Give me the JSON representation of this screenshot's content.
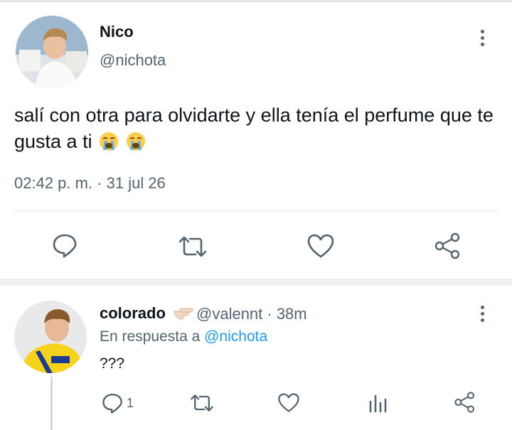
{
  "tweet": {
    "name": "Nico",
    "handle": "@nichota",
    "text": "salí con otra para olvidarte y ella tenía el perfume que te gusta a ti",
    "emojis": [
      "loudly-crying-face",
      "loudly-crying-face"
    ],
    "timestamp": "02:42 p. m. · 31 jul 26",
    "actions": [
      "reply-icon",
      "retweet-icon",
      "like-icon",
      "share-icon"
    ]
  },
  "reply": {
    "name": "colorado",
    "name_emoji": "pointing-hand",
    "handle_time": "@valennt · 38m",
    "replying_prefix": "En respuesta a",
    "replying_to": "@nichota",
    "text": "???",
    "reply_count": "1",
    "actions": [
      "reply-icon",
      "retweet-icon",
      "like-icon",
      "analytics-icon",
      "share-icon"
    ]
  },
  "colors": {
    "text": "#0f1419",
    "secondary": "#536471",
    "link": "#1d9bf0",
    "divider": "#e1e8ed"
  }
}
